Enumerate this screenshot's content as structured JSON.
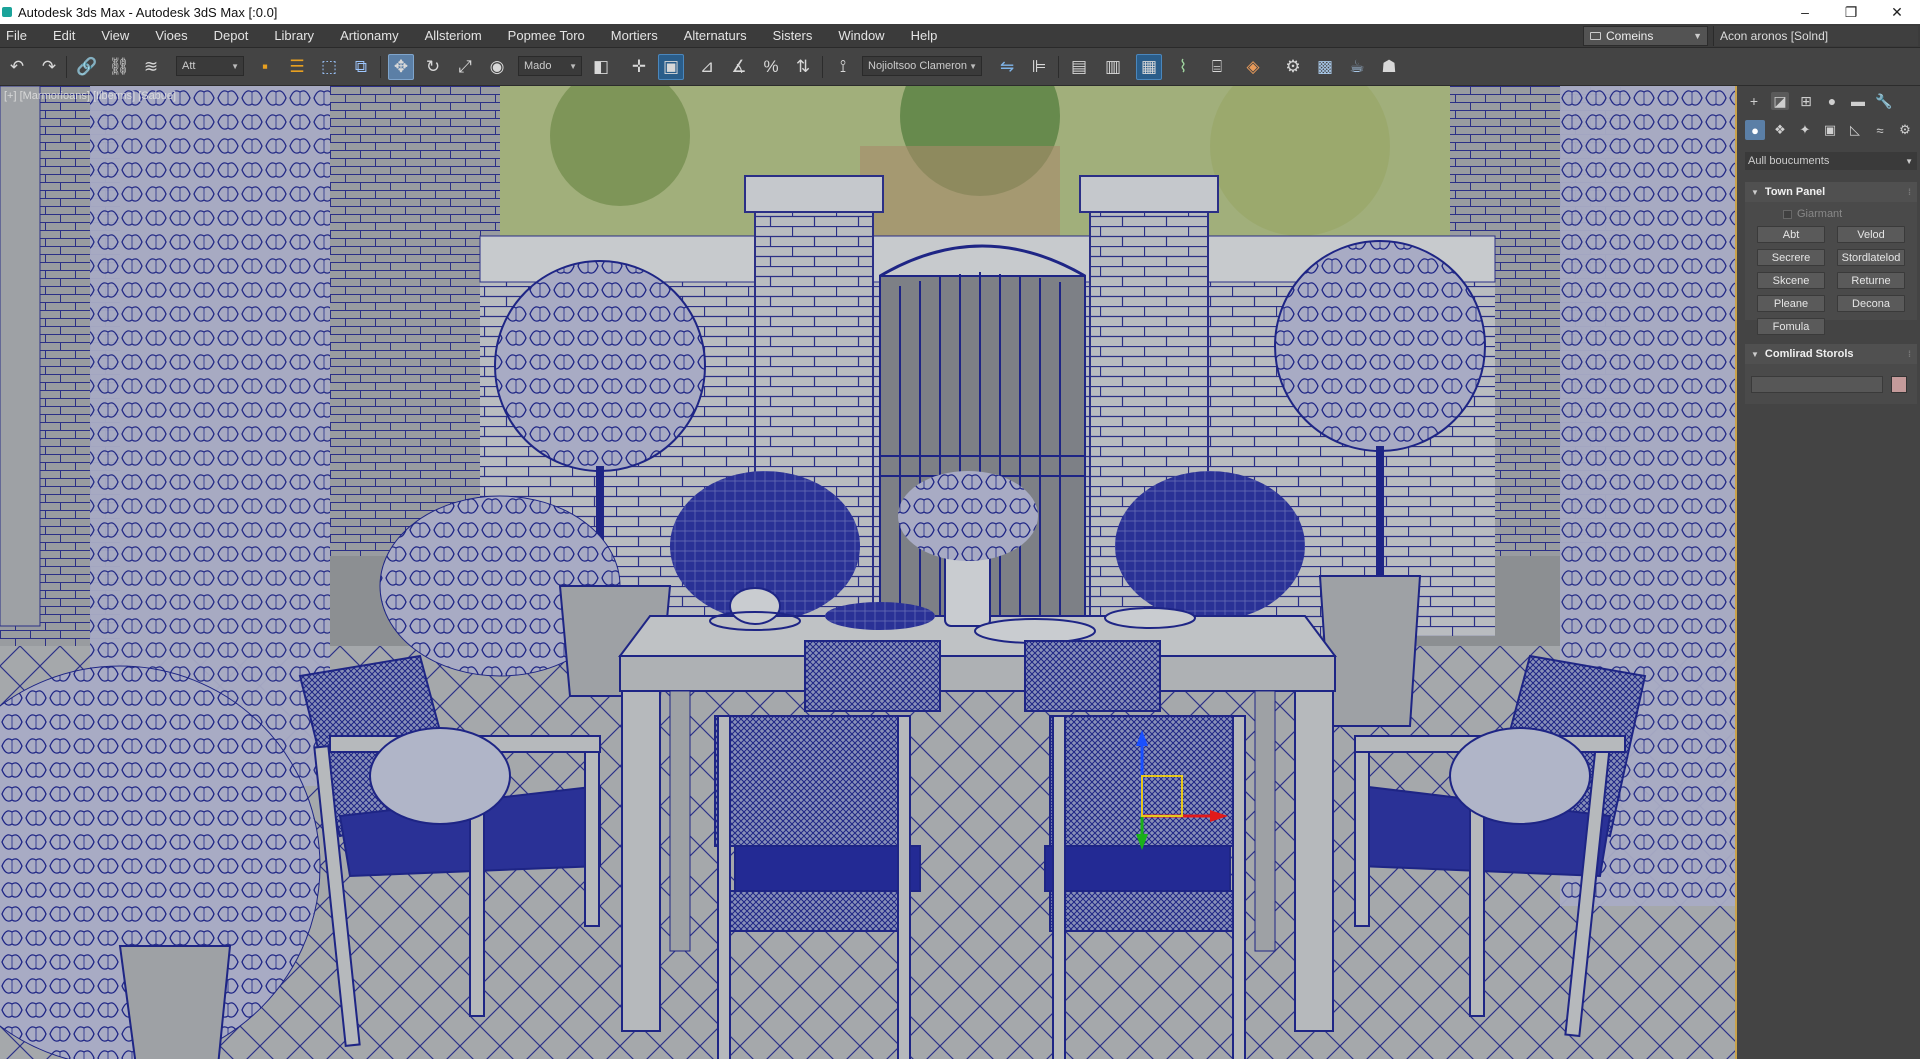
{
  "window": {
    "title": "Autodesk 3ds Max - Autodesk 3dS Max [:0.0]",
    "controls": [
      "–",
      "❐",
      "✕"
    ]
  },
  "menu": {
    "items": [
      "File",
      "Edit",
      "View",
      "Vioes",
      "Depot",
      "Library",
      "Artionamy",
      "Allsteriom",
      "Popmee Toro",
      "Mortiers",
      "Alternaturs",
      "Sisters",
      "Window",
      "Help"
    ],
    "workspace": "Comeins",
    "account": "Acon aronos [Solnd]"
  },
  "toolbar": {
    "selection_filter": "Att",
    "coord_system": "Mado",
    "named_selection": "Nojioltsoo Clameron"
  },
  "viewport": {
    "label": "[+] [Marmorioans] [Ilberms] [Sabue]"
  },
  "command_panel": {
    "category": "Aull boucuments",
    "rollout1": {
      "title": "Town Panel",
      "checkbox_label": "Giarmant",
      "buttons": [
        "Abt",
        "Velod",
        "Secrere",
        "Stordlatelod",
        "Skcene",
        "Returne",
        "Pleane",
        "Decona",
        "Fomula"
      ]
    },
    "rollout2": {
      "title": "Comlirad Storols"
    },
    "swatch_color": "#c49a9a"
  },
  "colors": {
    "accent": "#5b7fa6",
    "wire": "#1e2585",
    "viewport_bg": "#8c8f92"
  }
}
